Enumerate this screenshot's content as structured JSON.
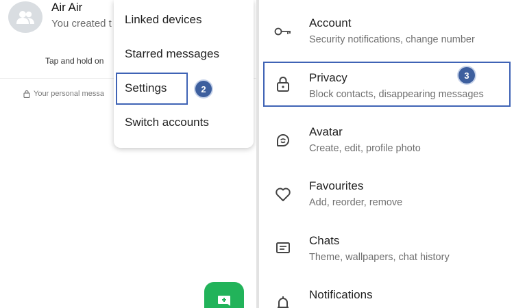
{
  "chat": {
    "group_name": "Air Air",
    "subtitle": "You created t",
    "tap_hint": "Tap and hold on",
    "encryption_note": "Your personal messa"
  },
  "menu": {
    "items": [
      {
        "label": "Linked devices"
      },
      {
        "label": "Starred messages"
      },
      {
        "label": "Settings"
      },
      {
        "label": "Switch accounts"
      }
    ]
  },
  "annotations": {
    "step2": "2",
    "step3": "3"
  },
  "settings": {
    "items": [
      {
        "title": "Account",
        "subtitle": "Security notifications, change number",
        "icon": "key-icon"
      },
      {
        "title": "Privacy",
        "subtitle": "Block contacts, disappearing messages",
        "icon": "lock-icon"
      },
      {
        "title": "Avatar",
        "subtitle": "Create, edit, profile photo",
        "icon": "avatar-icon"
      },
      {
        "title": "Favourites",
        "subtitle": "Add, reorder, remove",
        "icon": "heart-icon"
      },
      {
        "title": "Chats",
        "subtitle": "Theme, wallpapers, chat history",
        "icon": "chat-icon"
      },
      {
        "title": "Notifications",
        "subtitle": "",
        "icon": "bell-icon"
      }
    ]
  },
  "colors": {
    "accent_green": "#22b35a",
    "highlight_blue": "#3f63b5",
    "badge_blue": "#3d5f9e"
  }
}
